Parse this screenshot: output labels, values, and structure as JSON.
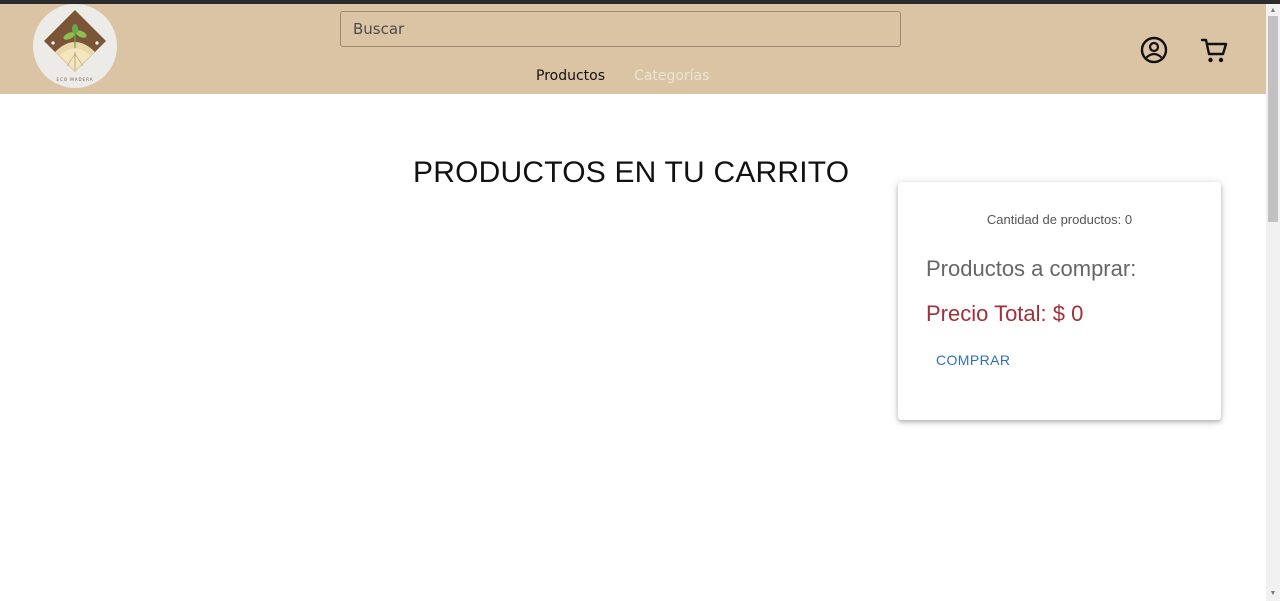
{
  "header": {
    "logo_text": "ECO MADERA",
    "search": {
      "placeholder": "Buscar",
      "value": ""
    },
    "nav": {
      "products_label": "Productos",
      "categories_label": "Categorías"
    },
    "icons": {
      "user": "user-circle-icon",
      "cart": "shopping-cart-icon"
    }
  },
  "main": {
    "title": "PRODUCTOS EN TU CARRITO"
  },
  "summary": {
    "count_text": "Cantidad de productos: 0",
    "to_buy_text": "Productos a comprar:",
    "total_text": "Precio Total: $ 0",
    "buy_label": "COMPRAR"
  },
  "colors": {
    "header_bg": "#dbc4a4",
    "total_red": "#a0303a",
    "button_blue": "#2f6fb8",
    "categories_text": "#ede3d4"
  }
}
